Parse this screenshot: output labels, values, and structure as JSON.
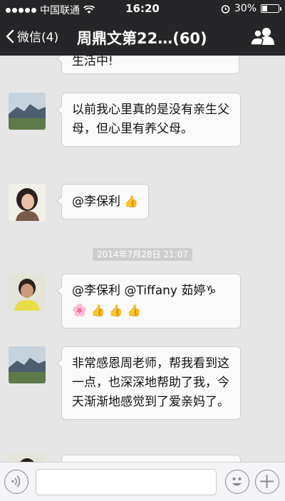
{
  "status_bar": {
    "carrier": "中国联通",
    "time": "16:20",
    "battery": "30%",
    "battery_level": 0.3
  },
  "nav": {
    "back_label": "微信(4)",
    "title": "周鼎文第22…(60)"
  },
  "messages": [
    {
      "text": "生活中!"
    },
    {
      "text": "以前我心里真的是没有亲生父母，但心里有养父母。"
    },
    {
      "text": "@李保利"
    },
    {
      "text_line1": "@李保利 @Tiffany 茹婷♑"
    },
    {
      "text": "非常感恩周老师，帮我看到这一点，也深深地帮助了我，今天渐渐地感觉到了爱亲妈了。"
    }
  ],
  "timestamp": "2014年7月28日 21:07",
  "icons": {
    "wifi": "wifi-icon",
    "alarm": "alarm-icon",
    "thumbs_up": "👍",
    "flower": "🌸",
    "capricorn": "♑"
  }
}
